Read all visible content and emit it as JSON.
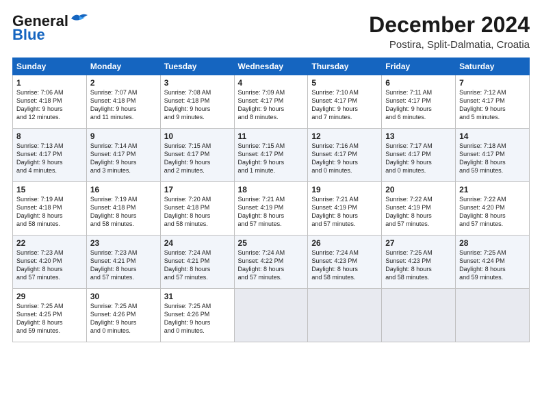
{
  "header": {
    "logo_general": "General",
    "logo_blue": "Blue",
    "title": "December 2024",
    "subtitle": "Postira, Split-Dalmatia, Croatia"
  },
  "weekdays": [
    "Sunday",
    "Monday",
    "Tuesday",
    "Wednesday",
    "Thursday",
    "Friday",
    "Saturday"
  ],
  "rows": [
    [
      {
        "day": "1",
        "lines": [
          "Sunrise: 7:06 AM",
          "Sunset: 4:18 PM",
          "Daylight: 9 hours",
          "and 12 minutes."
        ]
      },
      {
        "day": "2",
        "lines": [
          "Sunrise: 7:07 AM",
          "Sunset: 4:18 PM",
          "Daylight: 9 hours",
          "and 11 minutes."
        ]
      },
      {
        "day": "3",
        "lines": [
          "Sunrise: 7:08 AM",
          "Sunset: 4:18 PM",
          "Daylight: 9 hours",
          "and 9 minutes."
        ]
      },
      {
        "day": "4",
        "lines": [
          "Sunrise: 7:09 AM",
          "Sunset: 4:17 PM",
          "Daylight: 9 hours",
          "and 8 minutes."
        ]
      },
      {
        "day": "5",
        "lines": [
          "Sunrise: 7:10 AM",
          "Sunset: 4:17 PM",
          "Daylight: 9 hours",
          "and 7 minutes."
        ]
      },
      {
        "day": "6",
        "lines": [
          "Sunrise: 7:11 AM",
          "Sunset: 4:17 PM",
          "Daylight: 9 hours",
          "and 6 minutes."
        ]
      },
      {
        "day": "7",
        "lines": [
          "Sunrise: 7:12 AM",
          "Sunset: 4:17 PM",
          "Daylight: 9 hours",
          "and 5 minutes."
        ]
      }
    ],
    [
      {
        "day": "8",
        "lines": [
          "Sunrise: 7:13 AM",
          "Sunset: 4:17 PM",
          "Daylight: 9 hours",
          "and 4 minutes."
        ]
      },
      {
        "day": "9",
        "lines": [
          "Sunrise: 7:14 AM",
          "Sunset: 4:17 PM",
          "Daylight: 9 hours",
          "and 3 minutes."
        ]
      },
      {
        "day": "10",
        "lines": [
          "Sunrise: 7:15 AM",
          "Sunset: 4:17 PM",
          "Daylight: 9 hours",
          "and 2 minutes."
        ]
      },
      {
        "day": "11",
        "lines": [
          "Sunrise: 7:15 AM",
          "Sunset: 4:17 PM",
          "Daylight: 9 hours",
          "and 1 minute."
        ]
      },
      {
        "day": "12",
        "lines": [
          "Sunrise: 7:16 AM",
          "Sunset: 4:17 PM",
          "Daylight: 9 hours",
          "and 0 minutes."
        ]
      },
      {
        "day": "13",
        "lines": [
          "Sunrise: 7:17 AM",
          "Sunset: 4:17 PM",
          "Daylight: 9 hours",
          "and 0 minutes."
        ]
      },
      {
        "day": "14",
        "lines": [
          "Sunrise: 7:18 AM",
          "Sunset: 4:17 PM",
          "Daylight: 8 hours",
          "and 59 minutes."
        ]
      }
    ],
    [
      {
        "day": "15",
        "lines": [
          "Sunrise: 7:19 AM",
          "Sunset: 4:18 PM",
          "Daylight: 8 hours",
          "and 58 minutes."
        ]
      },
      {
        "day": "16",
        "lines": [
          "Sunrise: 7:19 AM",
          "Sunset: 4:18 PM",
          "Daylight: 8 hours",
          "and 58 minutes."
        ]
      },
      {
        "day": "17",
        "lines": [
          "Sunrise: 7:20 AM",
          "Sunset: 4:18 PM",
          "Daylight: 8 hours",
          "and 58 minutes."
        ]
      },
      {
        "day": "18",
        "lines": [
          "Sunrise: 7:21 AM",
          "Sunset: 4:19 PM",
          "Daylight: 8 hours",
          "and 57 minutes."
        ]
      },
      {
        "day": "19",
        "lines": [
          "Sunrise: 7:21 AM",
          "Sunset: 4:19 PM",
          "Daylight: 8 hours",
          "and 57 minutes."
        ]
      },
      {
        "day": "20",
        "lines": [
          "Sunrise: 7:22 AM",
          "Sunset: 4:19 PM",
          "Daylight: 8 hours",
          "and 57 minutes."
        ]
      },
      {
        "day": "21",
        "lines": [
          "Sunrise: 7:22 AM",
          "Sunset: 4:20 PM",
          "Daylight: 8 hours",
          "and 57 minutes."
        ]
      }
    ],
    [
      {
        "day": "22",
        "lines": [
          "Sunrise: 7:23 AM",
          "Sunset: 4:20 PM",
          "Daylight: 8 hours",
          "and 57 minutes."
        ]
      },
      {
        "day": "23",
        "lines": [
          "Sunrise: 7:23 AM",
          "Sunset: 4:21 PM",
          "Daylight: 8 hours",
          "and 57 minutes."
        ]
      },
      {
        "day": "24",
        "lines": [
          "Sunrise: 7:24 AM",
          "Sunset: 4:21 PM",
          "Daylight: 8 hours",
          "and 57 minutes."
        ]
      },
      {
        "day": "25",
        "lines": [
          "Sunrise: 7:24 AM",
          "Sunset: 4:22 PM",
          "Daylight: 8 hours",
          "and 57 minutes."
        ]
      },
      {
        "day": "26",
        "lines": [
          "Sunrise: 7:24 AM",
          "Sunset: 4:23 PM",
          "Daylight: 8 hours",
          "and 58 minutes."
        ]
      },
      {
        "day": "27",
        "lines": [
          "Sunrise: 7:25 AM",
          "Sunset: 4:23 PM",
          "Daylight: 8 hours",
          "and 58 minutes."
        ]
      },
      {
        "day": "28",
        "lines": [
          "Sunrise: 7:25 AM",
          "Sunset: 4:24 PM",
          "Daylight: 8 hours",
          "and 59 minutes."
        ]
      }
    ],
    [
      {
        "day": "29",
        "lines": [
          "Sunrise: 7:25 AM",
          "Sunset: 4:25 PM",
          "Daylight: 8 hours",
          "and 59 minutes."
        ]
      },
      {
        "day": "30",
        "lines": [
          "Sunrise: 7:25 AM",
          "Sunset: 4:26 PM",
          "Daylight: 9 hours",
          "and 0 minutes."
        ]
      },
      {
        "day": "31",
        "lines": [
          "Sunrise: 7:25 AM",
          "Sunset: 4:26 PM",
          "Daylight: 9 hours",
          "and 0 minutes."
        ]
      },
      null,
      null,
      null,
      null
    ]
  ]
}
